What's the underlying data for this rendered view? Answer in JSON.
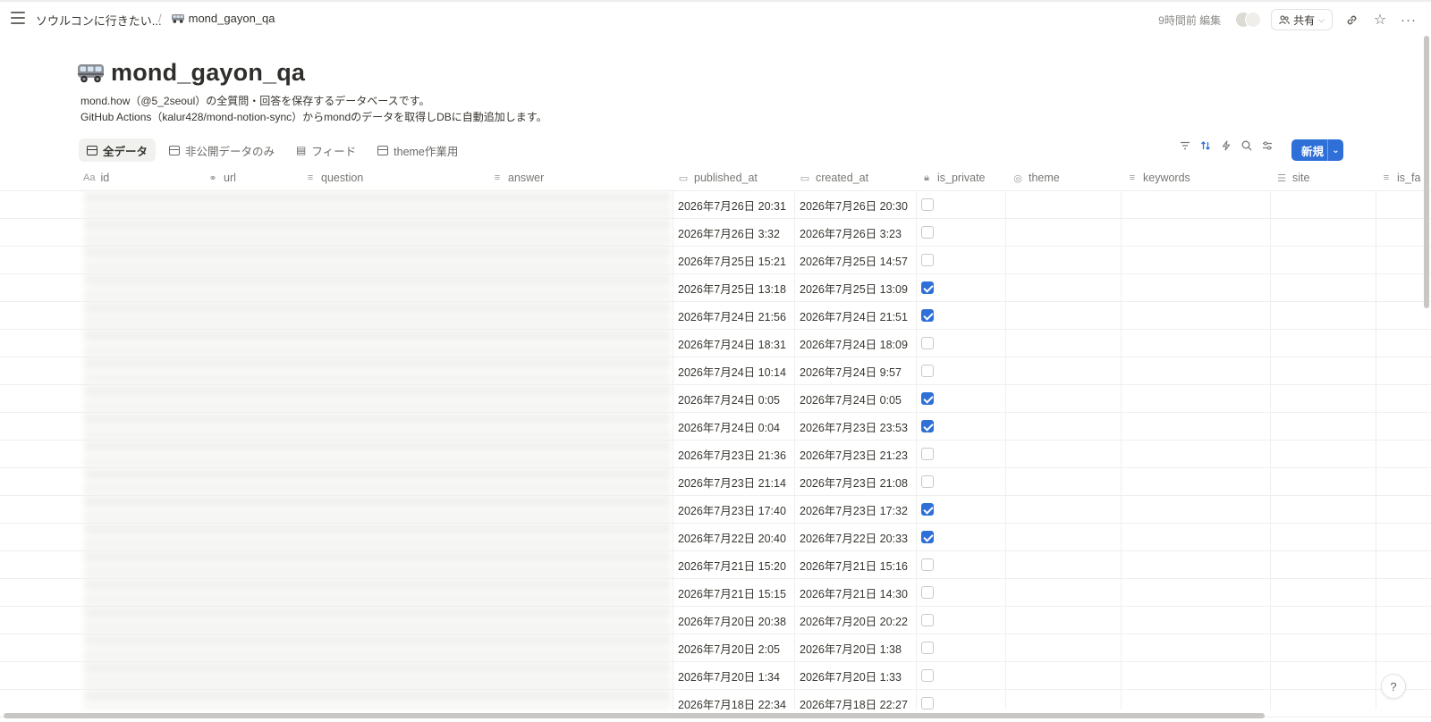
{
  "breadcrumb": {
    "parent": "ソウルコンに行きたい...",
    "current": "mond_gayon_qa"
  },
  "topbar": {
    "edited": "9時間前 編集",
    "share_label": "共有"
  },
  "page": {
    "title": "mond_gayon_qa",
    "description_line1": "mond.how（@5_2seoul）の全質問・回答を保存するデータベースです。",
    "description_line2": "GitHub Actions（kalur428/mond-notion-sync）からmondのデータを取得しDBに自動追加します。"
  },
  "views": [
    {
      "label": "全データ",
      "active": true
    },
    {
      "label": "非公開データのみ",
      "active": false
    },
    {
      "label": "フィード",
      "active": false
    },
    {
      "label": "theme作業用",
      "active": false
    }
  ],
  "new_button_label": "新規",
  "columns": [
    {
      "label": "id",
      "icon": "title-icon"
    },
    {
      "label": "url",
      "icon": "link-icon"
    },
    {
      "label": "question",
      "icon": "text-icon"
    },
    {
      "label": "answer",
      "icon": "text-icon"
    },
    {
      "label": "published_at",
      "icon": "calendar-icon"
    },
    {
      "label": "created_at",
      "icon": "calendar-icon"
    },
    {
      "label": "is_private",
      "icon": "lock-icon"
    },
    {
      "label": "theme",
      "icon": "status-icon"
    },
    {
      "label": "keywords",
      "icon": "text-icon"
    },
    {
      "label": "site",
      "icon": "list-icon"
    },
    {
      "label": "is_fa",
      "icon": "text-icon"
    }
  ],
  "rows": [
    {
      "published_at": "2026年7月26日 20:31",
      "created_at": "2026年7月26日 20:30",
      "is_private": false
    },
    {
      "published_at": "2026年7月26日 3:32",
      "created_at": "2026年7月26日 3:23",
      "is_private": false
    },
    {
      "published_at": "2026年7月25日 15:21",
      "created_at": "2026年7月25日 14:57",
      "is_private": false
    },
    {
      "published_at": "2026年7月25日 13:18",
      "created_at": "2026年7月25日 13:09",
      "is_private": true
    },
    {
      "published_at": "2026年7月24日 21:56",
      "created_at": "2026年7月24日 21:51",
      "is_private": true
    },
    {
      "published_at": "2026年7月24日 18:31",
      "created_at": "2026年7月24日 18:09",
      "is_private": false
    },
    {
      "published_at": "2026年7月24日 10:14",
      "created_at": "2026年7月24日 9:57",
      "is_private": false
    },
    {
      "published_at": "2026年7月24日 0:05",
      "created_at": "2026年7月24日 0:05",
      "is_private": true
    },
    {
      "published_at": "2026年7月24日 0:04",
      "created_at": "2026年7月23日 23:53",
      "is_private": true
    },
    {
      "published_at": "2026年7月23日 21:36",
      "created_at": "2026年7月23日 21:23",
      "is_private": false
    },
    {
      "published_at": "2026年7月23日 21:14",
      "created_at": "2026年7月23日 21:08",
      "is_private": false
    },
    {
      "published_at": "2026年7月23日 17:40",
      "created_at": "2026年7月23日 17:32",
      "is_private": true
    },
    {
      "published_at": "2026年7月22日 20:40",
      "created_at": "2026年7月22日 20:33",
      "is_private": true
    },
    {
      "published_at": "2026年7月21日 15:20",
      "created_at": "2026年7月21日 15:16",
      "is_private": false
    },
    {
      "published_at": "2026年7月21日 15:15",
      "created_at": "2026年7月21日 14:30",
      "is_private": false
    },
    {
      "published_at": "2026年7月20日 20:38",
      "created_at": "2026年7月20日 20:22",
      "is_private": false
    },
    {
      "published_at": "2026年7月20日 2:05",
      "created_at": "2026年7月20日 1:38",
      "is_private": false
    },
    {
      "published_at": "2026年7月20日 1:34",
      "created_at": "2026年7月20日 1:33",
      "is_private": false
    },
    {
      "published_at": "2026年7月18日 22:34",
      "created_at": "2026年7月18日 22:27",
      "is_private": false
    }
  ],
  "help_label": "?",
  "colors": {
    "accent": "#2f6fd8",
    "text": "#37352f",
    "muted": "#787774"
  }
}
